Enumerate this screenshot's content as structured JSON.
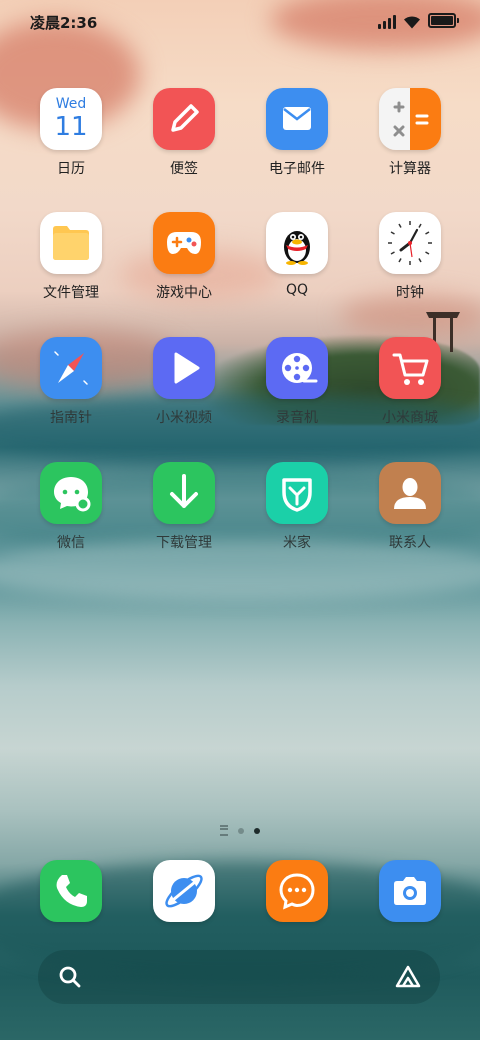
{
  "status_bar": {
    "time": "凌晨2:36",
    "signal_icon": "signal-icon",
    "wifi_icon": "wifi-icon",
    "battery_icon": "battery-icon",
    "battery_level": 0.9
  },
  "apps": [
    {
      "label": "日历",
      "icon": "calendar-icon",
      "weekday": "Wed",
      "day": "11"
    },
    {
      "label": "便签",
      "icon": "notes-icon"
    },
    {
      "label": "电子邮件",
      "icon": "mail-icon"
    },
    {
      "label": "计算器",
      "icon": "calculator-icon"
    },
    {
      "label": "文件管理",
      "icon": "folder-icon"
    },
    {
      "label": "游戏中心",
      "icon": "gamepad-icon"
    },
    {
      "label": "QQ",
      "icon": "penguin-icon"
    },
    {
      "label": "时钟",
      "icon": "clock-icon"
    },
    {
      "label": "指南针",
      "icon": "compass-icon"
    },
    {
      "label": "小米视频",
      "icon": "play-icon"
    },
    {
      "label": "录音机",
      "icon": "film-reel-icon"
    },
    {
      "label": "小米商城",
      "icon": "cart-icon"
    },
    {
      "label": "微信",
      "icon": "chat-bubble-icon"
    },
    {
      "label": "下载管理",
      "icon": "download-icon"
    },
    {
      "label": "米家",
      "icon": "mijia-icon"
    },
    {
      "label": "联系人",
      "icon": "contact-icon"
    }
  ],
  "page_indicator": {
    "pages": 2,
    "active_page": 2
  },
  "dock": [
    {
      "icon": "phone-icon"
    },
    {
      "icon": "browser-icon"
    },
    {
      "icon": "messages-icon"
    },
    {
      "icon": "camera-icon"
    }
  ],
  "search_bar": {
    "search_icon": "search-icon",
    "assistant_icon": "assistant-icon"
  },
  "colors": {
    "notes": "#f25455",
    "mail": "#3d8ef0",
    "calculator_orange": "#fb7c12",
    "folder_yellow": "#ffc751",
    "game_orange": "#fb7c12",
    "compass_blue": "#3d8ef0",
    "video_purple": "#5c6af3",
    "recorder_purple": "#5c6af3",
    "mall_red": "#f25455",
    "wechat_green": "#2cc55f",
    "download_green": "#2cc55f",
    "mijia_teal": "#1bd0a8",
    "contacts_brown": "#c1804f",
    "phone_green": "#2cc55f",
    "messages_orange": "#fb7c12",
    "camera_blue": "#3d8ef0"
  }
}
